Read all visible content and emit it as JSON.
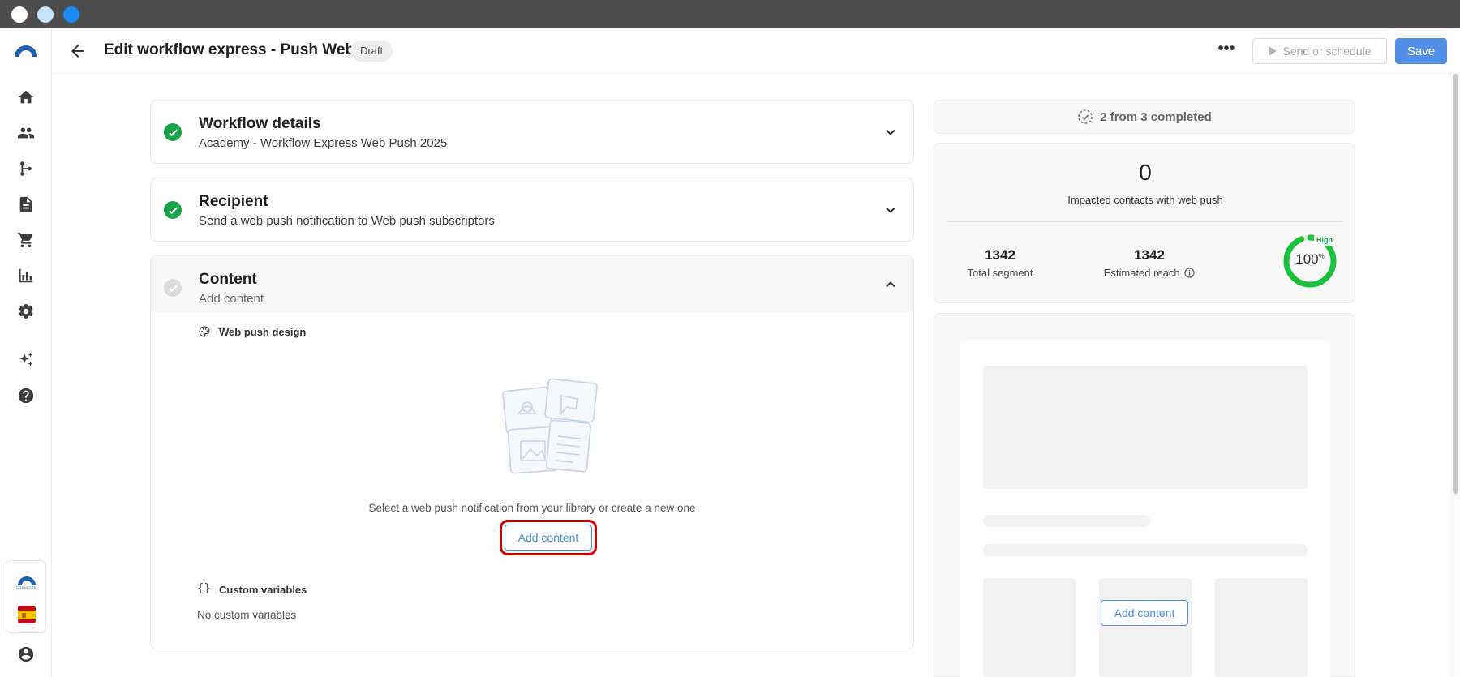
{
  "window": {
    "dots": [
      "#ffffff",
      "#c8e4fb",
      "#1a8cf0"
    ]
  },
  "header": {
    "title": "Edit workflow express - Push Web",
    "status_badge": "Draft",
    "more_glyph": "•••",
    "send_label": "Send or schedule",
    "save_label": "Save"
  },
  "sidebar": {
    "items": [
      "home-icon",
      "contacts-icon",
      "workflow-icon",
      "document-icon",
      "cart-icon",
      "chart-icon",
      "settings-icon",
      "ai-sparkle-icon",
      "help-icon"
    ],
    "brand_mini_text": "CONNECTIF",
    "language_flag": "es",
    "account": "account-icon"
  },
  "steps": {
    "workflow_details": {
      "title": "Workflow details",
      "subtitle": "Academy - Workflow Express Web Push 2025"
    },
    "recipient": {
      "title": "Recipient",
      "subtitle": "Send a web push notification to Web push subscriptors"
    },
    "content": {
      "title": "Content",
      "subtitle": "Add content",
      "design_label": "Web push design",
      "empty_text": "Select a web push notification from your library or create a new one",
      "add_button": "Add content",
      "custom_vars_braces": "{}",
      "custom_vars_label": "Custom variables",
      "no_custom_vars": "No custom variables"
    }
  },
  "summary": {
    "progress": "2 from 3 completed",
    "impacted_count": "0",
    "impacted_label": "Impacted contacts with web push",
    "total_segment_value": "1342",
    "total_segment_label": "Total segment",
    "estimated_reach_value": "1342",
    "estimated_reach_label": "Estimated reach",
    "gauge_value": "100",
    "gauge_unit": "%",
    "gauge_level": "High",
    "gauge_fraction": 1.0
  },
  "preview": {
    "add_button": "Add content"
  },
  "colors": {
    "accent": "#4f8fe8",
    "success": "#17a34a",
    "highlight": "#d30000"
  }
}
